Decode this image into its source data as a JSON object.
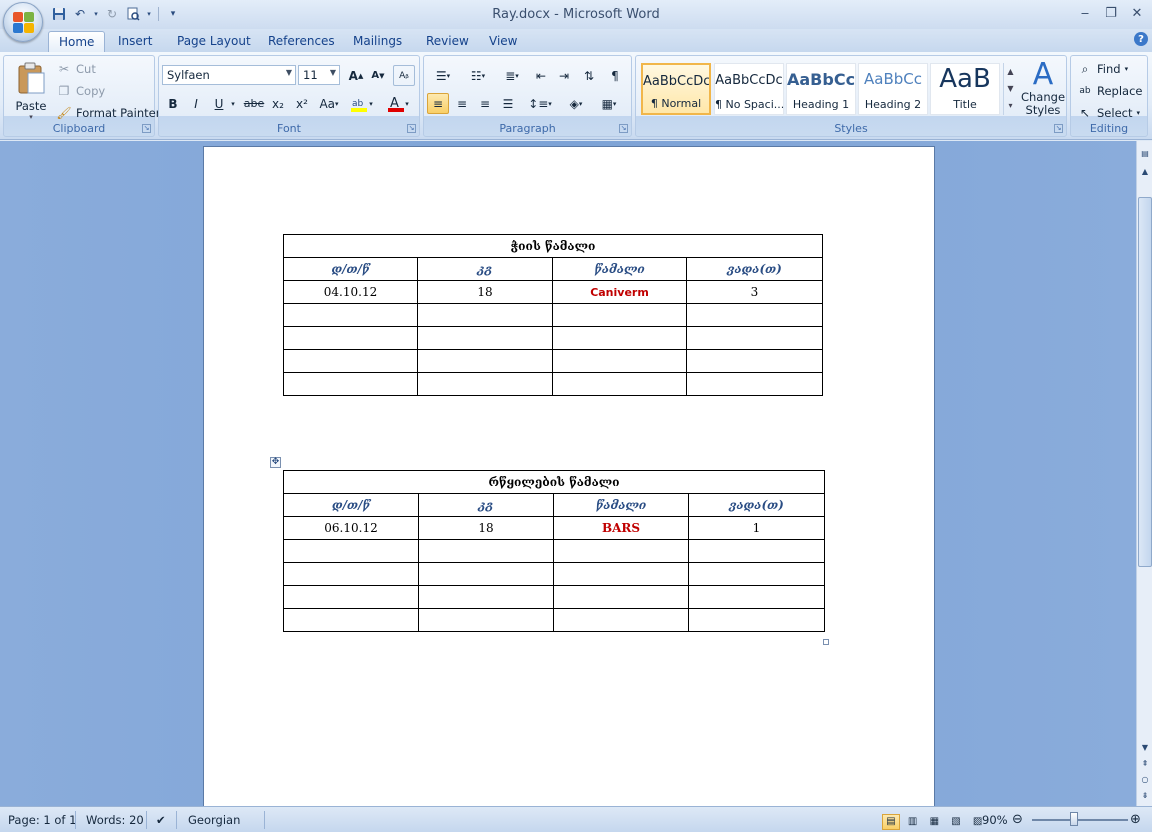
{
  "app": {
    "window_title": "Ray.docx - Microsoft Word"
  },
  "tabs": [
    "Home",
    "Insert",
    "Page Layout",
    "References",
    "Mailings",
    "Review",
    "View"
  ],
  "ribbon": {
    "clipboard": {
      "label": "Clipboard",
      "paste": "Paste",
      "cut": "Cut",
      "copy": "Copy",
      "format_painter": "Format Painter"
    },
    "font": {
      "label": "Font",
      "font_name": "Sylfaen",
      "font_size": "11",
      "grow": "A",
      "shrink": "A",
      "bold": "B",
      "italic": "I",
      "underline": "U",
      "strike": "abe",
      "subscript": "x₂",
      "superscript": "x²",
      "change_case": "Aa"
    },
    "paragraph": {
      "label": "Paragraph"
    },
    "styles": {
      "label": "Styles",
      "items": [
        {
          "sample": "AaBbCcDc",
          "name": "¶ Normal"
        },
        {
          "sample": "AaBbCcDc",
          "name": "¶ No Spaci..."
        },
        {
          "sample": "AaBbCc",
          "name": "Heading 1"
        },
        {
          "sample": "AaBbCc",
          "name": "Heading 2"
        },
        {
          "sample": "AaB",
          "name": "Title"
        }
      ],
      "change_styles": "Change Styles"
    },
    "editing": {
      "label": "Editing",
      "find": "Find",
      "replace": "Replace",
      "select": "Select"
    }
  },
  "document": {
    "tables": [
      {
        "title": "ჭიის წამალი",
        "headers": [
          "დ/თ/წ",
          "კგ",
          "წამალი",
          "ვადა(თ)"
        ],
        "rows": [
          [
            "04.10.12",
            "18",
            "Caniverm",
            "3"
          ],
          [
            "",
            "",
            "",
            ""
          ],
          [
            "",
            "",
            "",
            ""
          ],
          [
            "",
            "",
            "",
            ""
          ],
          [
            "",
            "",
            "",
            ""
          ]
        ]
      },
      {
        "title": "რწყილების წამალი",
        "headers": [
          "დ/თ/წ",
          "კგ",
          "წამალი",
          "ვადა(თ)"
        ],
        "rows": [
          [
            "06.10.12",
            "18",
            "BARS",
            "1"
          ],
          [
            "",
            "",
            "",
            ""
          ],
          [
            "",
            "",
            "",
            ""
          ],
          [
            "",
            "",
            "",
            ""
          ],
          [
            "",
            "",
            "",
            ""
          ]
        ]
      }
    ]
  },
  "status": {
    "page": "Page: 1 of 1",
    "words": "Words: 20",
    "language": "Georgian",
    "zoom": "90%"
  },
  "colors": {
    "accent": "#15428b",
    "drug_text": "#c00000",
    "header_text": "#2a4d84"
  }
}
